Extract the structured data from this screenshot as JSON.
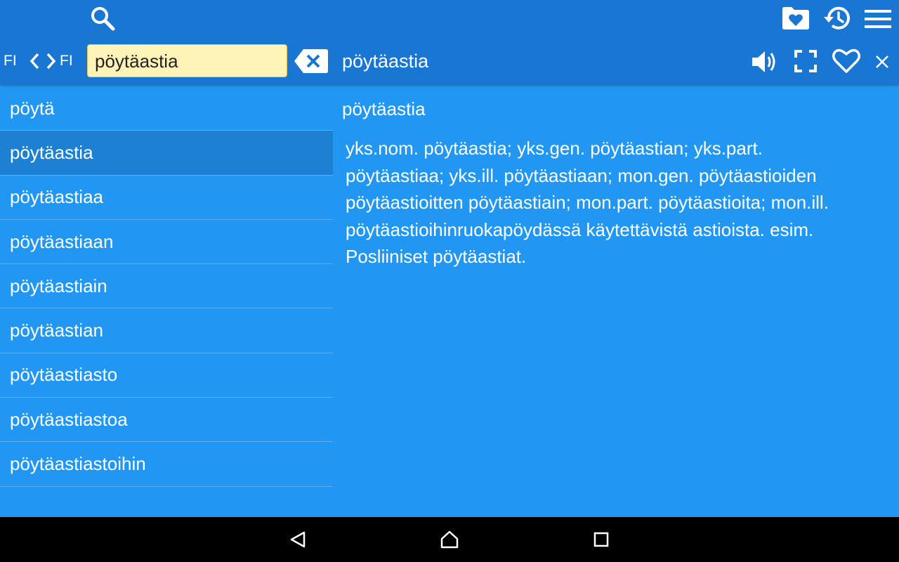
{
  "toolbar": {
    "icons": [
      "search-icon",
      "favorites-folder-icon",
      "history-icon",
      "menu-icon"
    ]
  },
  "search_bar": {
    "source_lang": "FI",
    "target_lang": "FI",
    "swap_icon": "swap-languages-icon",
    "query": "pöytäastia",
    "clear_icon": "backspace-clear-icon"
  },
  "header": {
    "word": "pöytäastia",
    "icons": [
      "speaker-icon",
      "fullscreen-icon",
      "heart-icon",
      "close-icon"
    ]
  },
  "word_list": [
    {
      "label": "pöytä",
      "selected": false
    },
    {
      "label": "pöytäastia",
      "selected": true
    },
    {
      "label": "pöytäastiaa",
      "selected": false
    },
    {
      "label": "pöytäastiaan",
      "selected": false
    },
    {
      "label": "pöytäastiain",
      "selected": false
    },
    {
      "label": "pöytäastian",
      "selected": false
    },
    {
      "label": "pöytäastiasto",
      "selected": false
    },
    {
      "label": "pöytäastiastoa",
      "selected": false
    },
    {
      "label": "pöytäastiastoihin",
      "selected": false
    }
  ],
  "definition": {
    "title": "pöytäastia",
    "lines": [
      "yks.nom. pöytäastia; yks.gen. pöytäastian; yks.part.",
      "pöytäastiaa; yks.ill. pöytäastiaan; mon.gen. pöytäastioiden",
      "pöytäastioitten pöytäastiain; mon.part. pöytäastioita; mon.ill.",
      "pöytäastioihinruokapöydässä käytettävistä astioista. esim.",
      "Posliiniset pöytäastiat."
    ]
  },
  "nav_bar": {
    "icons": [
      "back-icon",
      "home-icon",
      "recents-icon"
    ]
  },
  "colors": {
    "app_bar": "#1976D2",
    "content_bg": "#2196F3",
    "selected_row": "#1D80D2",
    "search_field_bg": "#FFF3B8"
  }
}
